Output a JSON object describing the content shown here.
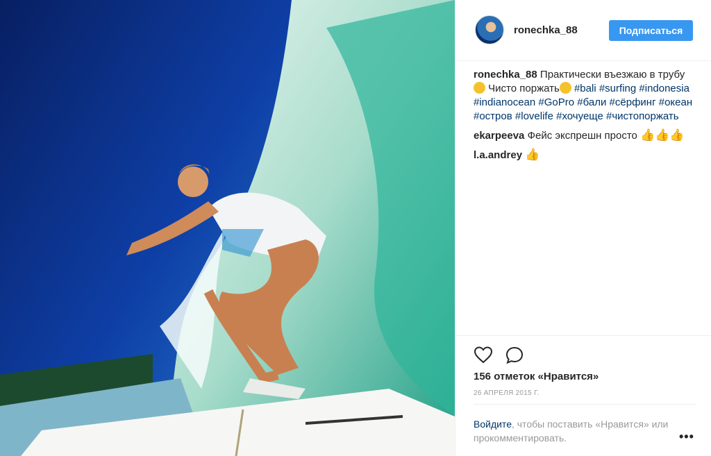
{
  "post": {
    "username": "ronechka_88",
    "follow_label": "Подписаться"
  },
  "caption": {
    "username": "ronechka_88",
    "text1": "Практически въезжаю в трубу",
    "emoji1": "😁",
    "text2": " Чисто поржать",
    "emoji2": "😂",
    "tags": [
      "#bali",
      "#surfing",
      "#indonesia",
      "#indianocean",
      "#GoPro",
      "#бали",
      "#сёрфинг",
      "#океан",
      "#остров",
      "#lovelife",
      "#хочуеще",
      "#чистопоржать"
    ]
  },
  "comments": [
    {
      "username": "ekarpeeva",
      "text": "Фейс экспрешн просто",
      "emoji": "👍👍👍"
    },
    {
      "username": "l.a.andrey",
      "text": "",
      "emoji": "👍"
    }
  ],
  "actions": {
    "like_icon": "heart-icon",
    "comment_icon": "comment-bubble-icon",
    "likes_text": "156 отметок «Нравится»",
    "date_text": "26 АПРЕЛЯ 2015 Г."
  },
  "login": {
    "link_text": "Войдите",
    "rest_text": ", чтобы поставить «Нравится» или прокомментировать.",
    "more_label": "•••"
  },
  "colors": {
    "accent": "#3897f0",
    "hashtag": "#003569",
    "text": "#262626",
    "muted": "#999999"
  }
}
